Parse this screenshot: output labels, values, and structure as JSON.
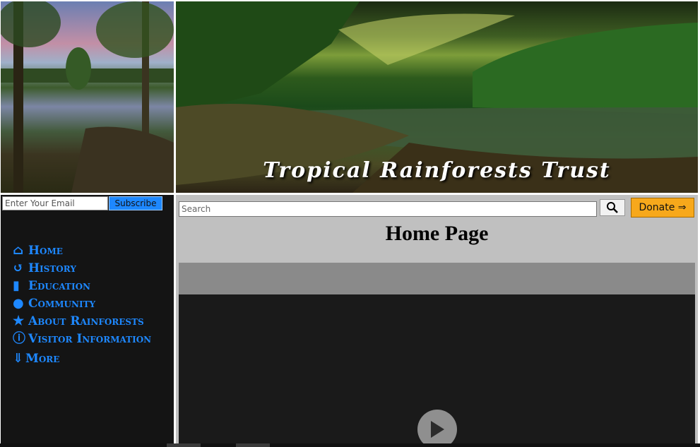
{
  "header": {
    "banner_title": "Tropical Rainforests Trust"
  },
  "newsletter": {
    "email_placeholder": "Enter Your Email",
    "subscribe_label": "Subscribe"
  },
  "nav": {
    "items": [
      {
        "label": "Home",
        "icon": "home-icon"
      },
      {
        "label": "History",
        "icon": "history-icon"
      },
      {
        "label": "Education",
        "icon": "book-icon"
      },
      {
        "label": "Community",
        "icon": "comments-icon"
      },
      {
        "label": "About Rainforests",
        "icon": "star-icon"
      },
      {
        "label": "Visitor Information",
        "icon": "info-icon"
      },
      {
        "label": "More",
        "icon": "arrow-down-icon"
      }
    ]
  },
  "search": {
    "placeholder": "Search"
  },
  "donate_label": "Donate ⇒",
  "page_title": "Home Page",
  "colors": {
    "nav_link": "#1e88ff",
    "sidebar_bg": "#141414",
    "main_bg": "#c0c0c0",
    "donate_bg": "#f7a81b",
    "subscribe_bg": "#1e88ff"
  }
}
